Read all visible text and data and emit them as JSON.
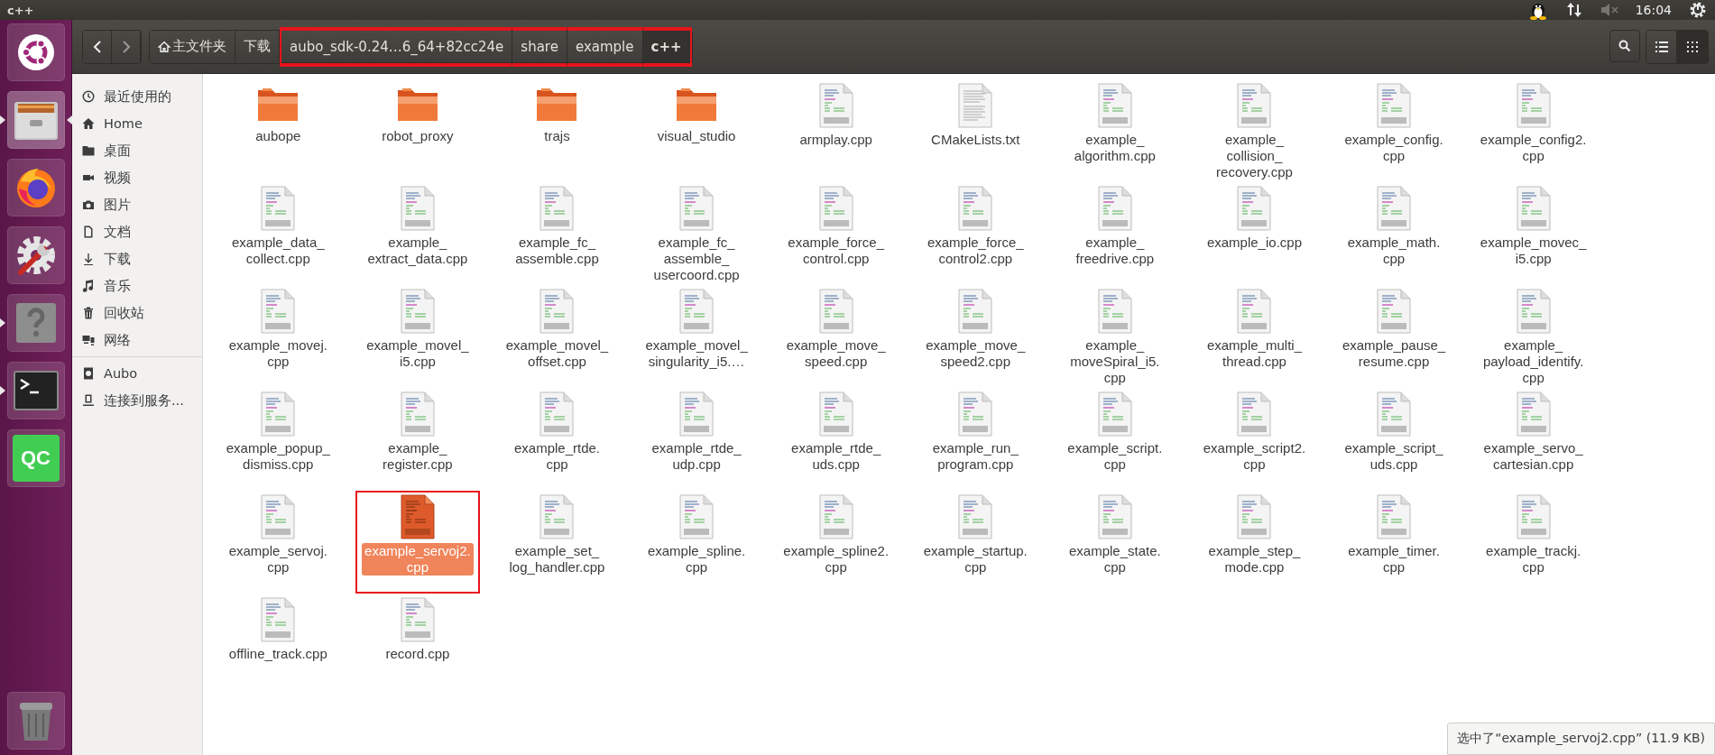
{
  "panel": {
    "title": "c++",
    "clock": "16:04",
    "muted": true
  },
  "launcher": [
    {
      "kind": "ubuntu",
      "running": false,
      "focused": false
    },
    {
      "kind": "files",
      "running": true,
      "focused": true
    },
    {
      "kind": "firefox",
      "running": false,
      "focused": false
    },
    {
      "kind": "settings",
      "running": false,
      "focused": false
    },
    {
      "kind": "help",
      "running": true,
      "focused": false
    },
    {
      "kind": "terminal",
      "running": true,
      "focused": false
    },
    {
      "kind": "qc",
      "label": "QC",
      "running": false,
      "focused": false
    },
    {
      "kind": "trash",
      "running": false,
      "focused": false
    }
  ],
  "breadcrumbs": [
    {
      "label": "主文件夹",
      "home": true,
      "selected": false,
      "marked": false
    },
    {
      "label": "下载",
      "home": false,
      "selected": false,
      "marked": false
    },
    {
      "label": "aubo_sdk-0.24…6_64+82cc24e",
      "home": false,
      "selected": false,
      "marked": true
    },
    {
      "label": "share",
      "home": false,
      "selected": false,
      "marked": true
    },
    {
      "label": "example",
      "home": false,
      "selected": false,
      "marked": true
    },
    {
      "label": "c++",
      "home": false,
      "selected": true,
      "marked": true
    }
  ],
  "view": {
    "grid_selected": true
  },
  "sidebar": {
    "places": [
      {
        "label": "最近使用的"
      },
      {
        "label": "Home"
      },
      {
        "label": "桌面"
      },
      {
        "label": "视频"
      },
      {
        "label": "图片"
      },
      {
        "label": "文档"
      },
      {
        "label": "下载"
      },
      {
        "label": "音乐"
      },
      {
        "label": "回收站"
      },
      {
        "label": "网络"
      }
    ],
    "devices": [
      {
        "label": "Aubo"
      },
      {
        "label": "连接到服务..."
      }
    ]
  },
  "files": [
    {
      "name": "aubope",
      "kind": "folder",
      "selected": false,
      "marked": false
    },
    {
      "name": "robot_proxy",
      "kind": "folder",
      "selected": false,
      "marked": false
    },
    {
      "name": "trajs",
      "kind": "folder",
      "selected": false,
      "marked": false
    },
    {
      "name": "visual_studio",
      "kind": "folder",
      "selected": false,
      "marked": false
    },
    {
      "name": "armplay.cpp",
      "kind": "cpp",
      "selected": false,
      "marked": false
    },
    {
      "name": "CMakeLists.txt",
      "kind": "text",
      "selected": false,
      "marked": false
    },
    {
      "name": "example_algorithm.cpp",
      "kind": "cpp",
      "selected": false,
      "marked": false
    },
    {
      "name": "example_collision_recovery.cpp",
      "kind": "cpp",
      "selected": false,
      "marked": false
    },
    {
      "name": "example_config.cpp",
      "kind": "cpp",
      "selected": false,
      "marked": false
    },
    {
      "name": "example_config2.cpp",
      "kind": "cpp",
      "selected": false,
      "marked": false
    },
    {
      "name": "example_data_collect.cpp",
      "kind": "cpp",
      "selected": false,
      "marked": false
    },
    {
      "name": "example_extract_data.cpp",
      "kind": "cpp",
      "selected": false,
      "marked": false
    },
    {
      "name": "example_fc_assemble.cpp",
      "kind": "cpp",
      "selected": false,
      "marked": false
    },
    {
      "name": "example_fc_assemble_usercoord.cpp",
      "kind": "cpp",
      "selected": false,
      "marked": false
    },
    {
      "name": "example_force_control.cpp",
      "kind": "cpp",
      "selected": false,
      "marked": false
    },
    {
      "name": "example_force_control2.cpp",
      "kind": "cpp",
      "selected": false,
      "marked": false
    },
    {
      "name": "example_freedrive.cpp",
      "kind": "cpp",
      "selected": false,
      "marked": false
    },
    {
      "name": "example_io.cpp",
      "kind": "cpp",
      "selected": false,
      "marked": false
    },
    {
      "name": "example_math.cpp",
      "kind": "cpp",
      "selected": false,
      "marked": false
    },
    {
      "name": "example_movec_i5.cpp",
      "kind": "cpp",
      "selected": false,
      "marked": false
    },
    {
      "name": "example_movej.cpp",
      "kind": "cpp",
      "selected": false,
      "marked": false
    },
    {
      "name": "example_movel_i5.cpp",
      "kind": "cpp",
      "selected": false,
      "marked": false
    },
    {
      "name": "example_movel_offset.cpp",
      "kind": "cpp",
      "selected": false,
      "marked": false
    },
    {
      "name": "example_movel_singularity_i5.…",
      "kind": "cpp",
      "selected": false,
      "marked": false
    },
    {
      "name": "example_move_speed.cpp",
      "kind": "cpp",
      "selected": false,
      "marked": false
    },
    {
      "name": "example_move_speed2.cpp",
      "kind": "cpp",
      "selected": false,
      "marked": false
    },
    {
      "name": "example_moveSpiral_i5.cpp",
      "kind": "cpp",
      "selected": false,
      "marked": false
    },
    {
      "name": "example_multi_thread.cpp",
      "kind": "cpp",
      "selected": false,
      "marked": false
    },
    {
      "name": "example_pause_resume.cpp",
      "kind": "cpp",
      "selected": false,
      "marked": false
    },
    {
      "name": "example_payload_identify.cpp",
      "kind": "cpp",
      "selected": false,
      "marked": false
    },
    {
      "name": "example_popup_dismiss.cpp",
      "kind": "cpp",
      "selected": false,
      "marked": false
    },
    {
      "name": "example_register.cpp",
      "kind": "cpp",
      "selected": false,
      "marked": false
    },
    {
      "name": "example_rtde.cpp",
      "kind": "cpp",
      "selected": false,
      "marked": false
    },
    {
      "name": "example_rtde_udp.cpp",
      "kind": "cpp",
      "selected": false,
      "marked": false
    },
    {
      "name": "example_rtde_uds.cpp",
      "kind": "cpp",
      "selected": false,
      "marked": false
    },
    {
      "name": "example_run_program.cpp",
      "kind": "cpp",
      "selected": false,
      "marked": false
    },
    {
      "name": "example_script.cpp",
      "kind": "cpp",
      "selected": false,
      "marked": false
    },
    {
      "name": "example_script2.cpp",
      "kind": "cpp",
      "selected": false,
      "marked": false
    },
    {
      "name": "example_script_uds.cpp",
      "kind": "cpp",
      "selected": false,
      "marked": false
    },
    {
      "name": "example_servo_cartesian.cpp",
      "kind": "cpp",
      "selected": false,
      "marked": false
    },
    {
      "name": "example_servoj.cpp",
      "kind": "cpp",
      "selected": false,
      "marked": false
    },
    {
      "name": "example_servoj2.cpp",
      "kind": "cpp",
      "selected": true,
      "marked": true
    },
    {
      "name": "example_set_log_handler.cpp",
      "kind": "cpp",
      "selected": false,
      "marked": false
    },
    {
      "name": "example_spline.cpp",
      "kind": "cpp",
      "selected": false,
      "marked": false
    },
    {
      "name": "example_spline2.cpp",
      "kind": "cpp",
      "selected": false,
      "marked": false
    },
    {
      "name": "example_startup.cpp",
      "kind": "cpp",
      "selected": false,
      "marked": false
    },
    {
      "name": "example_state.cpp",
      "kind": "cpp",
      "selected": false,
      "marked": false
    },
    {
      "name": "example_step_mode.cpp",
      "kind": "cpp",
      "selected": false,
      "marked": false
    },
    {
      "name": "example_timer.cpp",
      "kind": "cpp",
      "selected": false,
      "marked": false
    },
    {
      "name": "example_trackj.cpp",
      "kind": "cpp",
      "selected": false,
      "marked": false
    },
    {
      "name": "offline_track.cpp",
      "kind": "cpp",
      "selected": false,
      "marked": false
    },
    {
      "name": "record.cpp",
      "kind": "cpp",
      "selected": false,
      "marked": false
    }
  ],
  "status": "选中了“example_servoj2.cpp” (11.9 KB)"
}
